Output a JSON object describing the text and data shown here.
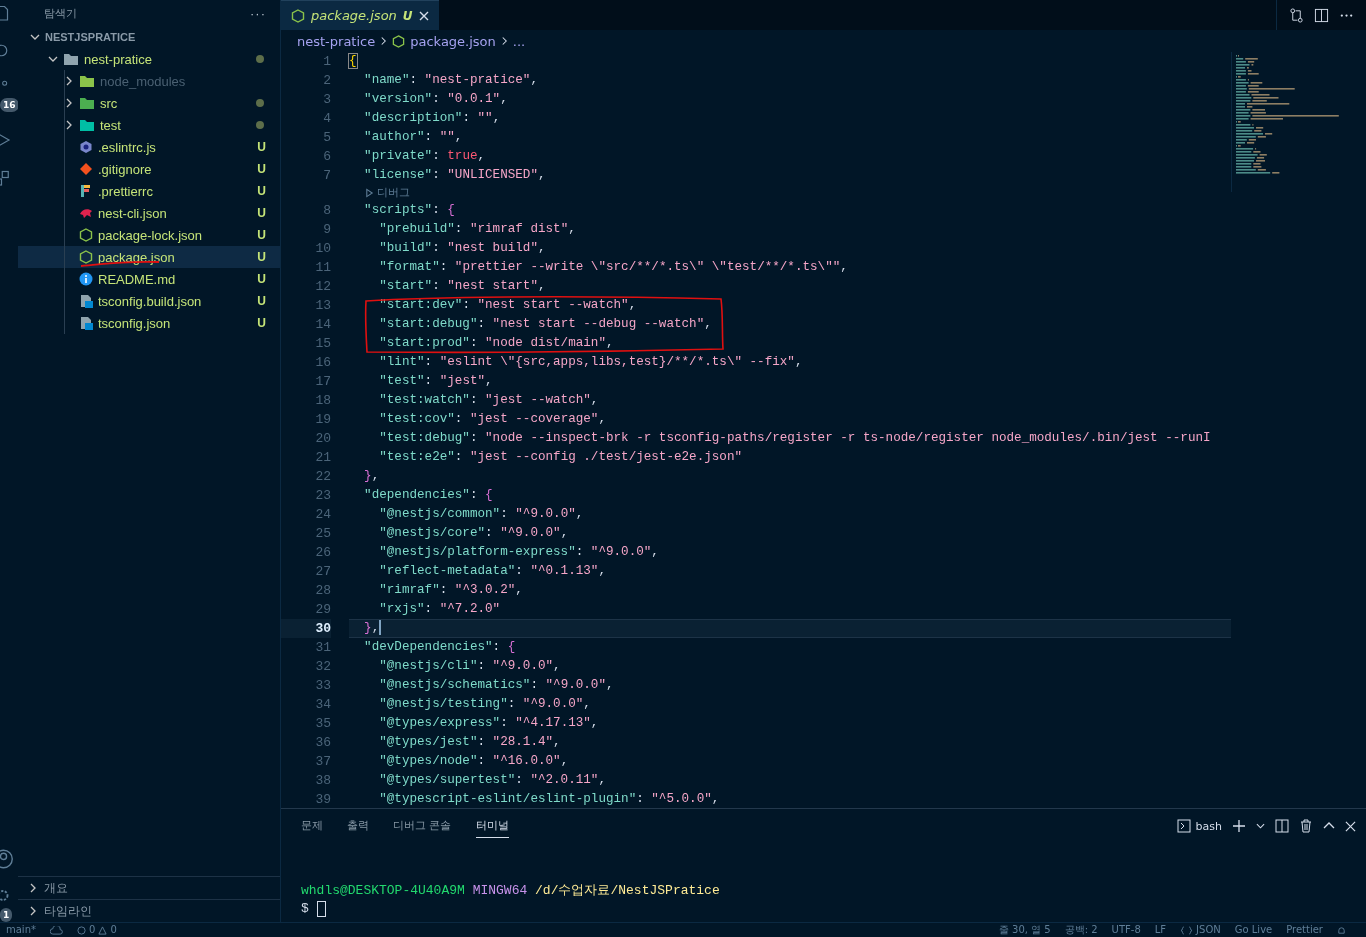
{
  "activity_bar": {
    "badges": [
      {
        "kind": "scm",
        "text": "16"
      },
      {
        "kind": "settings",
        "text": "1"
      }
    ]
  },
  "explorer": {
    "title": "탐색기",
    "more": "···",
    "workspace": {
      "label": "NESTJSPRATICE",
      "expanded": true
    },
    "tree": [
      {
        "label": "nest-pratice",
        "kind": "folder",
        "expanded": true,
        "dot": true,
        "selected": false,
        "children": [
          {
            "label": "node_modules",
            "kind": "folder-modules",
            "expanded": false,
            "ignored": true,
            "selected": false
          },
          {
            "label": "src",
            "kind": "folder-src",
            "expanded": false,
            "dot": true,
            "selected": false
          },
          {
            "label": "test",
            "kind": "folder-test",
            "expanded": false,
            "dot": true,
            "selected": false
          },
          {
            "label": ".eslintrc.js",
            "kind": "eslint",
            "status": "U",
            "selected": false
          },
          {
            "label": ".gitignore",
            "kind": "git",
            "status": "U",
            "selected": false
          },
          {
            "label": ".prettierrc",
            "kind": "prettier",
            "status": "U",
            "selected": false
          },
          {
            "label": "nest-cli.json",
            "kind": "nest",
            "status": "U",
            "selected": false
          },
          {
            "label": "package-lock.json",
            "kind": "node",
            "status": "U",
            "selected": false
          },
          {
            "label": "package.json",
            "kind": "node",
            "status": "U",
            "selected": true
          },
          {
            "label": "README.md",
            "kind": "info",
            "status": "U",
            "selected": false
          },
          {
            "label": "tsconfig.build.json",
            "kind": "ts",
            "status": "U",
            "selected": false
          },
          {
            "label": "tsconfig.json",
            "kind": "ts",
            "status": "U",
            "selected": false
          }
        ]
      }
    ],
    "sections": [
      {
        "label": "개요",
        "expanded": false
      },
      {
        "label": "타임라인",
        "expanded": false
      }
    ]
  },
  "tabs": [
    {
      "label": "package.json",
      "status": "U",
      "selected": true
    }
  ],
  "breadcrumbs": [
    "nest-pratice",
    "package.json",
    "..."
  ],
  "code": [
    {
      "n": "1",
      "value": "{",
      "kind": "brace",
      "selected": false
    },
    {
      "n": "2",
      "key": "  \"name\"",
      "sep": ": ",
      "value": "\"nest-pratice\"",
      "kind": "string",
      "end": ",",
      "selected": false
    },
    {
      "n": "3",
      "key": "  \"version\"",
      "sep": ": ",
      "value": "\"0.0.1\"",
      "kind": "string",
      "end": ",",
      "selected": false
    },
    {
      "n": "4",
      "key": "  \"description\"",
      "sep": ": ",
      "value": "\"\"",
      "kind": "string",
      "end": ",",
      "selected": false
    },
    {
      "n": "5",
      "key": "  \"author\"",
      "sep": ": ",
      "value": "\"\"",
      "kind": "string",
      "end": ",",
      "selected": false
    },
    {
      "n": "6",
      "key": "  \"private\"",
      "sep": ": ",
      "value": "true",
      "kind": "bool",
      "end": ",",
      "selected": false
    },
    {
      "n": "7",
      "key": "  \"license\"",
      "sep": ": ",
      "value": "\"UNLICENSED\"",
      "kind": "string",
      "end": ",",
      "selected": false
    },
    {
      "kind": "codelens",
      "value": "디버그"
    },
    {
      "n": "8",
      "key": "  \"scripts\"",
      "sep": ": ",
      "value": "{",
      "kind": "brace2",
      "selected": false
    },
    {
      "n": "9",
      "key": "    \"prebuild\"",
      "sep": ": ",
      "value": "\"rimraf dist\"",
      "kind": "string",
      "end": ",",
      "selected": false
    },
    {
      "n": "10",
      "key": "    \"build\"",
      "sep": ": ",
      "value": "\"nest build\"",
      "kind": "string",
      "end": ",",
      "selected": false
    },
    {
      "n": "11",
      "key": "    \"format\"",
      "sep": ": ",
      "value": "\"prettier --write \\\"src/**/*.ts\\\" \\\"test/**/*.ts\\\"\"",
      "kind": "string",
      "end": ",",
      "selected": false
    },
    {
      "n": "12",
      "key": "    \"start\"",
      "sep": ": ",
      "value": "\"nest start\"",
      "kind": "string",
      "end": ",",
      "selected": false
    },
    {
      "n": "13",
      "key": "    \"start:dev\"",
      "sep": ": ",
      "value": "\"nest start --watch\"",
      "kind": "string",
      "end": ",",
      "selected": false
    },
    {
      "n": "14",
      "key": "    \"start:debug\"",
      "sep": ": ",
      "value": "\"nest start --debug --watch\"",
      "kind": "string",
      "end": ",",
      "selected": false
    },
    {
      "n": "15",
      "key": "    \"start:prod\"",
      "sep": ": ",
      "value": "\"node dist/main\"",
      "kind": "string",
      "end": ",",
      "selected": false
    },
    {
      "n": "16",
      "key": "    \"lint\"",
      "sep": ": ",
      "value": "\"eslint \\\"{src,apps,libs,test}/**/*.ts\\\" --fix\"",
      "kind": "string",
      "end": ",",
      "selected": false
    },
    {
      "n": "17",
      "key": "    \"test\"",
      "sep": ": ",
      "value": "\"jest\"",
      "kind": "string",
      "end": ",",
      "selected": false
    },
    {
      "n": "18",
      "key": "    \"test:watch\"",
      "sep": ": ",
      "value": "\"jest --watch\"",
      "kind": "string",
      "end": ",",
      "selected": false
    },
    {
      "n": "19",
      "key": "    \"test:cov\"",
      "sep": ": ",
      "value": "\"jest --coverage\"",
      "kind": "string",
      "end": ",",
      "selected": false
    },
    {
      "n": "20",
      "key": "    \"test:debug\"",
      "sep": ": ",
      "value": "\"node --inspect-brk -r tsconfig-paths/register -r ts-node/register node_modules/.bin/jest --runI",
      "kind": "string",
      "selected": false
    },
    {
      "n": "21",
      "key": "    \"test:e2e\"",
      "sep": ": ",
      "value": "\"jest --config ./test/jest-e2e.json\"",
      "kind": "string",
      "selected": false
    },
    {
      "n": "22",
      "value": "  }",
      "kind": "brace2",
      "end": ",",
      "selected": false
    },
    {
      "n": "23",
      "key": "  \"dependencies\"",
      "sep": ": ",
      "value": "{",
      "kind": "brace2",
      "selected": false
    },
    {
      "n": "24",
      "key": "    \"@nestjs/common\"",
      "sep": ": ",
      "value": "\"^9.0.0\"",
      "kind": "string",
      "end": ",",
      "selected": false
    },
    {
      "n": "25",
      "key": "    \"@nestjs/core\"",
      "sep": ": ",
      "value": "\"^9.0.0\"",
      "kind": "string",
      "end": ",",
      "selected": false
    },
    {
      "n": "26",
      "key": "    \"@nestjs/platform-express\"",
      "sep": ": ",
      "value": "\"^9.0.0\"",
      "kind": "string",
      "end": ",",
      "selected": false
    },
    {
      "n": "27",
      "key": "    \"reflect-metadata\"",
      "sep": ": ",
      "value": "\"^0.1.13\"",
      "kind": "string",
      "end": ",",
      "selected": false
    },
    {
      "n": "28",
      "key": "    \"rimraf\"",
      "sep": ": ",
      "value": "\"^3.0.2\"",
      "kind": "string",
      "end": ",",
      "selected": false
    },
    {
      "n": "29",
      "key": "    \"rxjs\"",
      "sep": ": ",
      "value": "\"^7.2.0\"",
      "kind": "string",
      "selected": false
    },
    {
      "n": "30",
      "value": "  }",
      "kind": "brace2",
      "end": ",",
      "selected": true
    },
    {
      "n": "31",
      "key": "  \"devDependencies\"",
      "sep": ": ",
      "value": "{",
      "kind": "brace2",
      "selected": false
    },
    {
      "n": "32",
      "key": "    \"@nestjs/cli\"",
      "sep": ": ",
      "value": "\"^9.0.0\"",
      "kind": "string",
      "end": ",",
      "selected": false
    },
    {
      "n": "33",
      "key": "    \"@nestjs/schematics\"",
      "sep": ": ",
      "value": "\"^9.0.0\"",
      "kind": "string",
      "end": ",",
      "selected": false
    },
    {
      "n": "34",
      "key": "    \"@nestjs/testing\"",
      "sep": ": ",
      "value": "\"^9.0.0\"",
      "kind": "string",
      "end": ",",
      "selected": false
    },
    {
      "n": "35",
      "key": "    \"@types/express\"",
      "sep": ": ",
      "value": "\"^4.17.13\"",
      "kind": "string",
      "end": ",",
      "selected": false
    },
    {
      "n": "36",
      "key": "    \"@types/jest\"",
      "sep": ": ",
      "value": "\"28.1.4\"",
      "kind": "string",
      "end": ",",
      "selected": false
    },
    {
      "n": "37",
      "key": "    \"@types/node\"",
      "sep": ": ",
      "value": "\"^16.0.0\"",
      "kind": "string",
      "end": ",",
      "selected": false
    },
    {
      "n": "38",
      "key": "    \"@types/supertest\"",
      "sep": ": ",
      "value": "\"^2.0.11\"",
      "kind": "string",
      "end": ",",
      "selected": false
    },
    {
      "n": "39",
      "key": "    \"@typescript-eslint/eslint-plugin\"",
      "sep": ": ",
      "value": "\"^5.0.0\"",
      "kind": "string",
      "end": ",",
      "selected": false
    }
  ],
  "panel": {
    "tabs": [
      {
        "label": "문제",
        "selected": false
      },
      {
        "label": "출력",
        "selected": false
      },
      {
        "label": "디버그 콘솔",
        "selected": false
      },
      {
        "label": "터미널",
        "selected": true
      }
    ],
    "shell": "bash",
    "terminal": {
      "user": "whdls@DESKTOP-4U40A9M",
      "system": "MINGW64",
      "path": "/d/수업자료/NestJSPratice",
      "prompt": "$"
    }
  },
  "status_bar": {
    "branch": "main*",
    "errors": "0",
    "warnings": "0",
    "position": "줄 30, 열 5",
    "indent": "공백: 2",
    "encoding": "UTF-8",
    "eol": "LF",
    "language": "JSON",
    "items": [
      "Go Live",
      "Prettier"
    ]
  }
}
